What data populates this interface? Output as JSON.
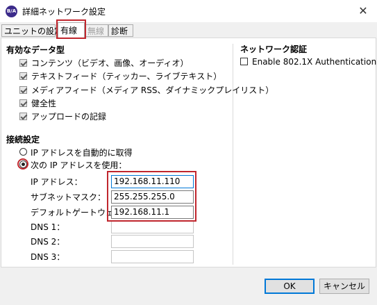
{
  "window": {
    "title": "詳細ネットワーク設定",
    "app_icon_text": "B/A"
  },
  "tabs": [
    {
      "label": "ユニットの設定"
    },
    {
      "label": "有線"
    },
    {
      "label": "無線"
    },
    {
      "label": "診断"
    }
  ],
  "valid_data": {
    "title": "有効なデータ型",
    "items": [
      {
        "label": "コンテンツ（ビデオ、画像、オーディオ）",
        "checked": true
      },
      {
        "label": "テキストフィード（ティッカー、ライブテキスト）",
        "checked": true
      },
      {
        "label": "メディアフィード（メディア RSS、ダイナミックプレイリスト）",
        "checked": true
      },
      {
        "label": "健全性",
        "checked": true
      },
      {
        "label": "アップロードの記録",
        "checked": true
      }
    ]
  },
  "connection": {
    "title": "接続設定",
    "auto_ip_label": "IP アドレスを自動的に取得",
    "manual_ip_label": "次の IP アドレスを使用：",
    "selected": "manual",
    "fields": {
      "ip": {
        "label": "IP アドレス：",
        "value": "192.168.11.110"
      },
      "subnet": {
        "label": "サブネットマスク：",
        "value": "255.255.255.0"
      },
      "gateway": {
        "label": "デフォルトゲートウェイ：",
        "value": "192.168.11.1"
      },
      "dns1": {
        "label": "DNS 1：",
        "value": ""
      },
      "dns2": {
        "label": "DNS 2：",
        "value": ""
      },
      "dns3": {
        "label": "DNS 3：",
        "value": ""
      }
    }
  },
  "network_auth": {
    "title": "ネットワーク認証",
    "enable_label": "Enable 802.1X Authentication",
    "enabled": false
  },
  "buttons": {
    "ok": "OK",
    "cancel": "キャンセル"
  },
  "colors": {
    "highlight": "#c0262d",
    "focus": "#0078d7"
  }
}
